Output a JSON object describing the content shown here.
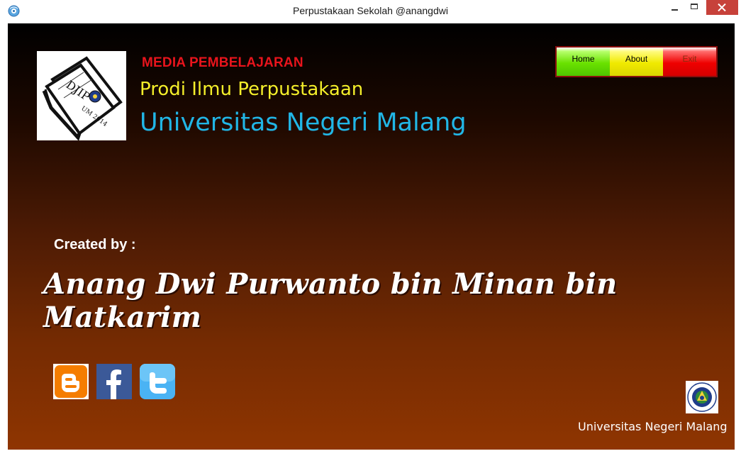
{
  "window": {
    "title": "Perpustakaan Sekolah @anangdwi"
  },
  "header": {
    "media_title": "MEDIA PEMBELAJARAN",
    "prodi": "Prodi Ilmu Perpustakaan",
    "university": "Universitas Negeri Malang",
    "logo_text_top": "DJIP",
    "logo_text_bottom": "UM 2014"
  },
  "nav": {
    "home": "Home",
    "about": "About",
    "exit": "Exit"
  },
  "credits": {
    "created_by": "Created by :",
    "author": "Anang Dwi Purwanto bin Minan bin Matkarim"
  },
  "social": {
    "items": [
      "blogger-icon",
      "facebook-icon",
      "twitter-icon"
    ]
  },
  "footer": {
    "university": "Universitas Negeri Malang"
  },
  "colors": {
    "media_title": "#e8141c",
    "prodi": "#f4ee2a",
    "university": "#21b6e6",
    "home": "#6ae200",
    "about": "#f0ea00",
    "exit": "#ef0000"
  }
}
